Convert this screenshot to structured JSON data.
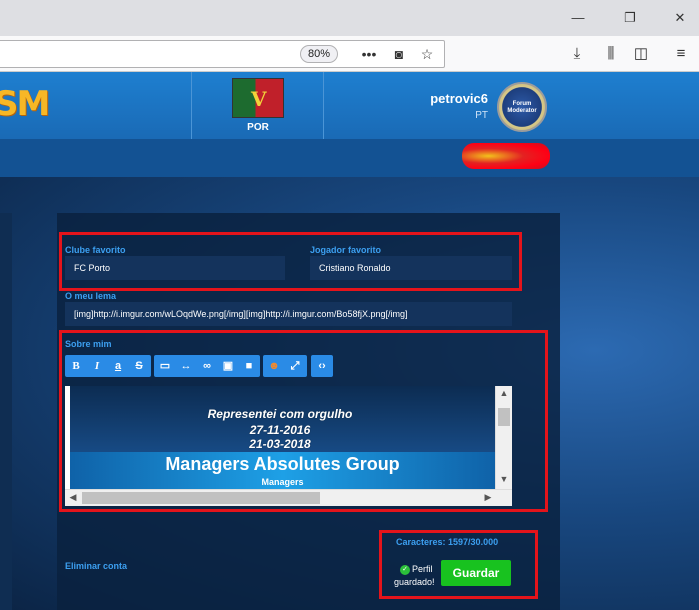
{
  "browser": {
    "zoom": "80%",
    "window_buttons": [
      "minimize",
      "restore",
      "close"
    ]
  },
  "header": {
    "club_code": "POR",
    "club_letter": "V",
    "username": "petrovic6",
    "country": "PT",
    "badge_text": "Forum Moderator"
  },
  "form": {
    "favorite_club_label": "Clube favorito",
    "favorite_club_value": "FC Porto",
    "favorite_player_label": "Jogador favorito",
    "favorite_player_value": "Cristiano Ronaldo",
    "motto_label": "O meu lema",
    "motto_value": "[img]http://i.imgur.com/wLOqdWe.png[/img][img]http://i.imgur.com/Bo58fjX.png[/img]",
    "about_label": "Sobre mim",
    "toolbar": {
      "bold": "B",
      "italic": "I",
      "underline": "a",
      "strike": "S"
    },
    "editor": {
      "line1": "Representei com orgulho",
      "line2": "27-11-2016",
      "line3": "21-03-2018",
      "banner_title": "Managers Absolutes Group",
      "banner_sub": "Managers"
    },
    "char_count": "Caracteres: 1597/30.000",
    "delete_account": "Eliminar conta",
    "saved_message": "Perfil guardado!",
    "save_button": "Guardar"
  },
  "colors": {
    "accent": "#3c9ff0",
    "save_green": "#18c21f",
    "highlight_red": "#e4141b"
  }
}
